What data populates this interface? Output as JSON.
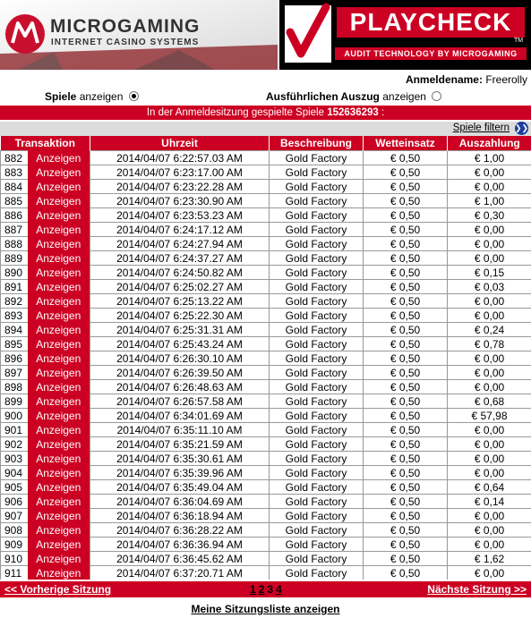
{
  "header": {
    "mg_title": "MICROGAMING",
    "mg_subtitle": "INTERNET CASINO SYSTEMS",
    "pc_title": "PLAYCHECK",
    "pc_subtitle": "AUDIT TECHNOLOGY BY MICROGAMING",
    "tm": "TM"
  },
  "login": {
    "label": "Anmeldename:",
    "value": "Freerolly"
  },
  "options": {
    "games_bold": "Spiele",
    "games_rest": " anzeigen",
    "detail_bold": "Ausführlichen Auszug",
    "detail_rest": " anzeigen",
    "selected": "games"
  },
  "session_bar": {
    "text": "In der Anmeldesitzung gespielte Spiele ",
    "id": "152636293",
    "suffix": " :"
  },
  "filter": {
    "label": "Spiele filtern",
    "icon": "double-chevron-down-icon"
  },
  "table": {
    "headers": [
      "Transaktion",
      "Uhrzeit",
      "Beschreibung",
      "Wetteinsatz",
      "Auszahlung"
    ],
    "rows": [
      {
        "id": "882",
        "action": "Anzeigen",
        "time": "2014/04/07 6:22:57.03 AM",
        "desc": "Gold Factory",
        "bet": "€ 0,50",
        "payout": "€ 1,00"
      },
      {
        "id": "883",
        "action": "Anzeigen",
        "time": "2014/04/07 6:23:17.00 AM",
        "desc": "Gold Factory",
        "bet": "€ 0,50",
        "payout": "€ 0,00"
      },
      {
        "id": "884",
        "action": "Anzeigen",
        "time": "2014/04/07 6:23:22.28 AM",
        "desc": "Gold Factory",
        "bet": "€ 0,50",
        "payout": "€ 0,00"
      },
      {
        "id": "885",
        "action": "Anzeigen",
        "time": "2014/04/07 6:23:30.90 AM",
        "desc": "Gold Factory",
        "bet": "€ 0,50",
        "payout": "€ 1,00"
      },
      {
        "id": "886",
        "action": "Anzeigen",
        "time": "2014/04/07 6:23:53.23 AM",
        "desc": "Gold Factory",
        "bet": "€ 0,50",
        "payout": "€ 0,30"
      },
      {
        "id": "887",
        "action": "Anzeigen",
        "time": "2014/04/07 6:24:17.12 AM",
        "desc": "Gold Factory",
        "bet": "€ 0,50",
        "payout": "€ 0,00"
      },
      {
        "id": "888",
        "action": "Anzeigen",
        "time": "2014/04/07 6:24:27.94 AM",
        "desc": "Gold Factory",
        "bet": "€ 0,50",
        "payout": "€ 0,00"
      },
      {
        "id": "889",
        "action": "Anzeigen",
        "time": "2014/04/07 6:24:37.27 AM",
        "desc": "Gold Factory",
        "bet": "€ 0,50",
        "payout": "€ 0,00"
      },
      {
        "id": "890",
        "action": "Anzeigen",
        "time": "2014/04/07 6:24:50.82 AM",
        "desc": "Gold Factory",
        "bet": "€ 0,50",
        "payout": "€ 0,15"
      },
      {
        "id": "891",
        "action": "Anzeigen",
        "time": "2014/04/07 6:25:02.27 AM",
        "desc": "Gold Factory",
        "bet": "€ 0,50",
        "payout": "€ 0,03"
      },
      {
        "id": "892",
        "action": "Anzeigen",
        "time": "2014/04/07 6:25:13.22 AM",
        "desc": "Gold Factory",
        "bet": "€ 0,50",
        "payout": "€ 0,00"
      },
      {
        "id": "893",
        "action": "Anzeigen",
        "time": "2014/04/07 6:25:22.30 AM",
        "desc": "Gold Factory",
        "bet": "€ 0,50",
        "payout": "€ 0,00"
      },
      {
        "id": "894",
        "action": "Anzeigen",
        "time": "2014/04/07 6:25:31.31 AM",
        "desc": "Gold Factory",
        "bet": "€ 0,50",
        "payout": "€ 0,24"
      },
      {
        "id": "895",
        "action": "Anzeigen",
        "time": "2014/04/07 6:25:43.24 AM",
        "desc": "Gold Factory",
        "bet": "€ 0,50",
        "payout": "€ 0,78"
      },
      {
        "id": "896",
        "action": "Anzeigen",
        "time": "2014/04/07 6:26:30.10 AM",
        "desc": "Gold Factory",
        "bet": "€ 0,50",
        "payout": "€ 0,00"
      },
      {
        "id": "897",
        "action": "Anzeigen",
        "time": "2014/04/07 6:26:39.50 AM",
        "desc": "Gold Factory",
        "bet": "€ 0,50",
        "payout": "€ 0,00"
      },
      {
        "id": "898",
        "action": "Anzeigen",
        "time": "2014/04/07 6:26:48.63 AM",
        "desc": "Gold Factory",
        "bet": "€ 0,50",
        "payout": "€ 0,00"
      },
      {
        "id": "899",
        "action": "Anzeigen",
        "time": "2014/04/07 6:26:57.58 AM",
        "desc": "Gold Factory",
        "bet": "€ 0,50",
        "payout": "€ 0,68"
      },
      {
        "id": "900",
        "action": "Anzeigen",
        "time": "2014/04/07 6:34:01.69 AM",
        "desc": "Gold Factory",
        "bet": "€ 0,50",
        "payout": "€ 57,98"
      },
      {
        "id": "901",
        "action": "Anzeigen",
        "time": "2014/04/07 6:35:11.10 AM",
        "desc": "Gold Factory",
        "bet": "€ 0,50",
        "payout": "€ 0,00"
      },
      {
        "id": "902",
        "action": "Anzeigen",
        "time": "2014/04/07 6:35:21.59 AM",
        "desc": "Gold Factory",
        "bet": "€ 0,50",
        "payout": "€ 0,00"
      },
      {
        "id": "903",
        "action": "Anzeigen",
        "time": "2014/04/07 6:35:30.61 AM",
        "desc": "Gold Factory",
        "bet": "€ 0,50",
        "payout": "€ 0,00"
      },
      {
        "id": "904",
        "action": "Anzeigen",
        "time": "2014/04/07 6:35:39.96 AM",
        "desc": "Gold Factory",
        "bet": "€ 0,50",
        "payout": "€ 0,00"
      },
      {
        "id": "905",
        "action": "Anzeigen",
        "time": "2014/04/07 6:35:49.04 AM",
        "desc": "Gold Factory",
        "bet": "€ 0,50",
        "payout": "€ 0,64"
      },
      {
        "id": "906",
        "action": "Anzeigen",
        "time": "2014/04/07 6:36:04.69 AM",
        "desc": "Gold Factory",
        "bet": "€ 0,50",
        "payout": "€ 0,14"
      },
      {
        "id": "907",
        "action": "Anzeigen",
        "time": "2014/04/07 6:36:18.94 AM",
        "desc": "Gold Factory",
        "bet": "€ 0,50",
        "payout": "€ 0,00"
      },
      {
        "id": "908",
        "action": "Anzeigen",
        "time": "2014/04/07 6:36:28.22 AM",
        "desc": "Gold Factory",
        "bet": "€ 0,50",
        "payout": "€ 0,00"
      },
      {
        "id": "909",
        "action": "Anzeigen",
        "time": "2014/04/07 6:36:36.94 AM",
        "desc": "Gold Factory",
        "bet": "€ 0,50",
        "payout": "€ 0,00"
      },
      {
        "id": "910",
        "action": "Anzeigen",
        "time": "2014/04/07 6:36:45.62 AM",
        "desc": "Gold Factory",
        "bet": "€ 0,50",
        "payout": "€ 1,62"
      },
      {
        "id": "911",
        "action": "Anzeigen",
        "time": "2014/04/07 6:37:20.71 AM",
        "desc": "Gold Factory",
        "bet": "€ 0,50",
        "payout": "€ 0,00"
      }
    ]
  },
  "nav": {
    "prev": "<< Vorherige Sitzung",
    "next": "Nächste Sitzung >>",
    "pages": [
      {
        "label": "1",
        "current": false
      },
      {
        "label": "2",
        "current": false
      },
      {
        "label": "3",
        "current": true
      },
      {
        "label": "4",
        "current": false
      }
    ]
  },
  "footer": {
    "link": "Meine Sitzungsliste anzeigen"
  },
  "colors": {
    "accent_red": "#cc0022",
    "filter_icon_blue": "#1e3f9c"
  }
}
